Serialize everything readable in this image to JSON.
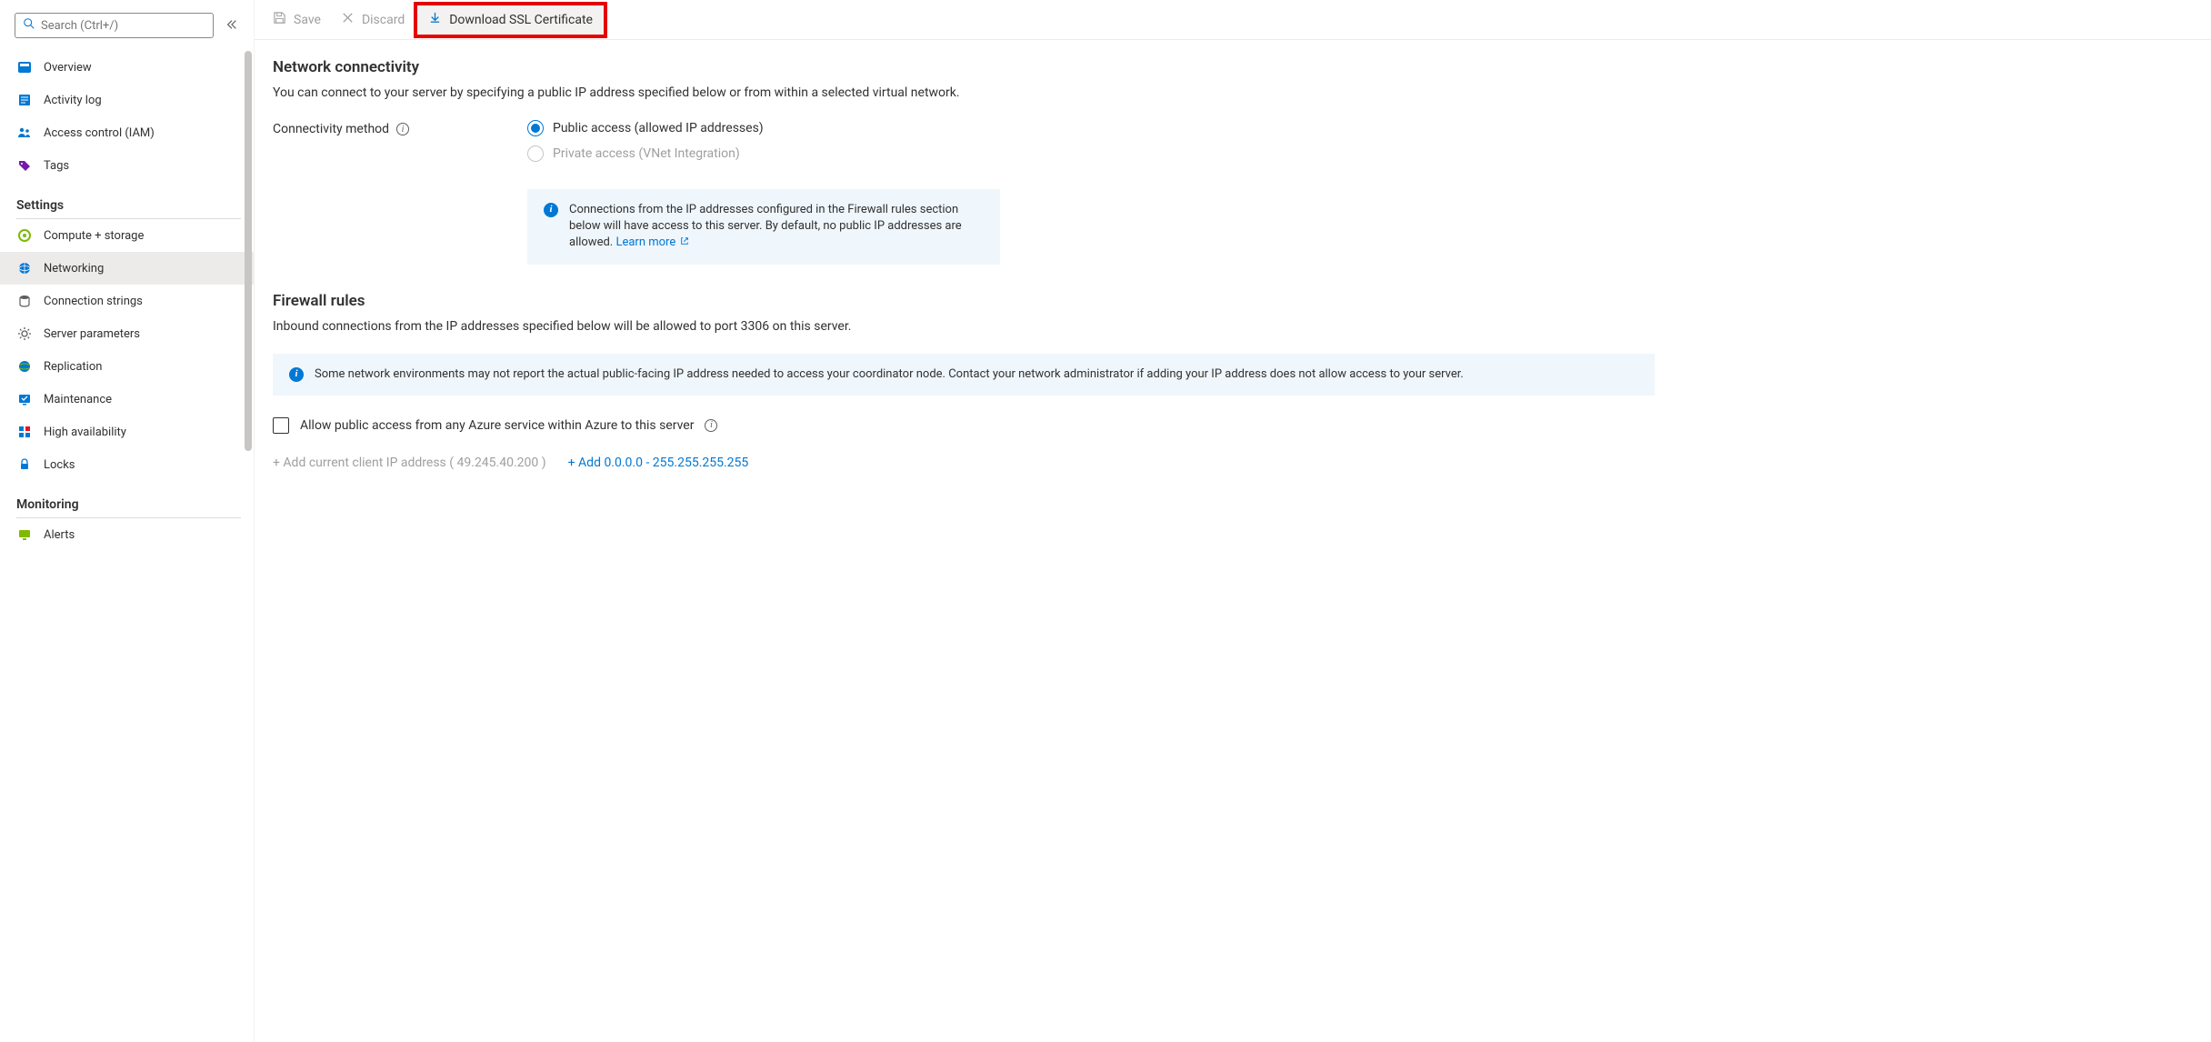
{
  "sidebar": {
    "search_placeholder": "Search (Ctrl+/)",
    "items_top": [
      {
        "label": "Overview"
      },
      {
        "label": "Activity log"
      },
      {
        "label": "Access control (IAM)"
      },
      {
        "label": "Tags"
      }
    ],
    "section_settings": "Settings",
    "items_settings": [
      {
        "label": "Compute + storage"
      },
      {
        "label": "Networking"
      },
      {
        "label": "Connection strings"
      },
      {
        "label": "Server parameters"
      },
      {
        "label": "Replication"
      },
      {
        "label": "Maintenance"
      },
      {
        "label": "High availability"
      },
      {
        "label": "Locks"
      }
    ],
    "section_monitoring": "Monitoring",
    "items_monitoring": [
      {
        "label": "Alerts"
      }
    ]
  },
  "toolbar": {
    "save": "Save",
    "discard": "Discard",
    "download": "Download SSL Certificate"
  },
  "connectivity": {
    "title": "Network connectivity",
    "desc": "You can connect to your server by specifying a public IP address specified below or from within a selected virtual network.",
    "method_label": "Connectivity method",
    "option_public": "Public access (allowed IP addresses)",
    "option_private": "Private access (VNet Integration)",
    "info_text": "Connections from the IP addresses configured in the Firewall rules section below will have access to this server. By default, no public IP addresses are allowed.",
    "learn_more": "Learn more"
  },
  "firewall": {
    "title": "Firewall rules",
    "desc": "Inbound connections from the IP addresses specified below will be allowed to port 3306 on this server.",
    "info_wide": "Some network environments may not report the actual public-facing IP address needed to access your coordinator node. Contact your network administrator if adding your IP address does not allow access to your server.",
    "allow_azure": "Allow public access from any Azure service within Azure to this server",
    "add_current": "+ Add current client IP address ( 49.245.40.200 )",
    "add_range": "+ Add 0.0.0.0 - 255.255.255.255"
  }
}
